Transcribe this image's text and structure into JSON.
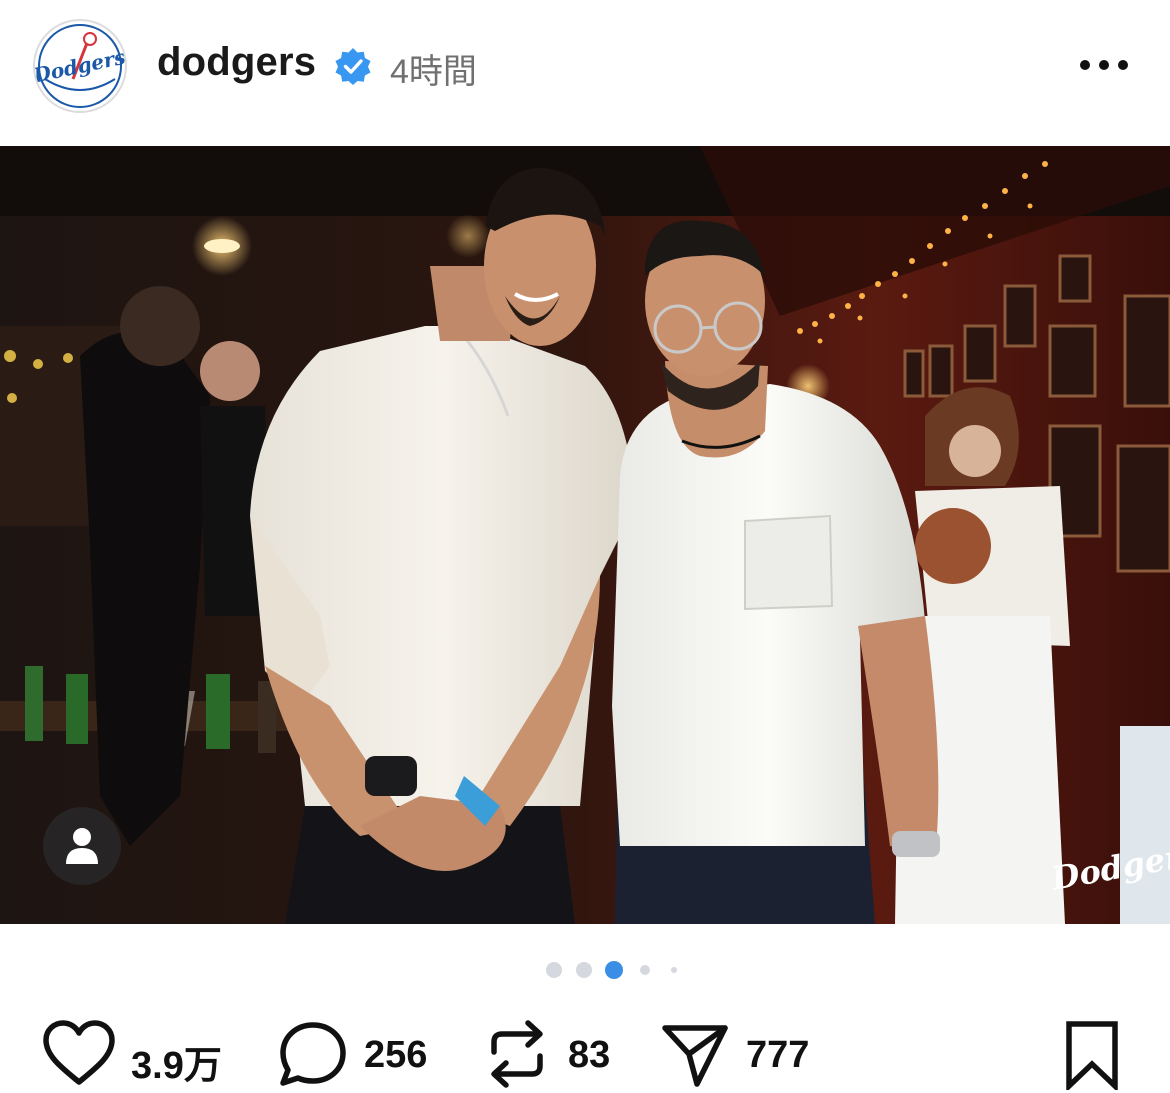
{
  "post": {
    "username": "dodgers",
    "time": "4時間",
    "avatar_text": "Dodgers",
    "verified": true
  },
  "image": {
    "watermark": "Dodgers",
    "carousel": {
      "count": 5,
      "active_index": 2
    }
  },
  "actions": {
    "likes": "3.9万",
    "comments": "256",
    "reposts": "83",
    "shares": "777"
  },
  "colors": {
    "verified_blue": "#3897f0",
    "active_dot": "#3a8ee6",
    "inactive_dot": "#d5d8de",
    "dodgers_blue": "#1a58a8",
    "dodgers_red": "#d6343c"
  },
  "icons": {
    "more": "more-options-icon",
    "verified": "verified-badge-icon",
    "tag": "user-tag-icon",
    "like": "heart-icon",
    "comment": "comment-bubble-icon",
    "repost": "repost-icon",
    "share": "send-icon",
    "save": "bookmark-icon"
  }
}
